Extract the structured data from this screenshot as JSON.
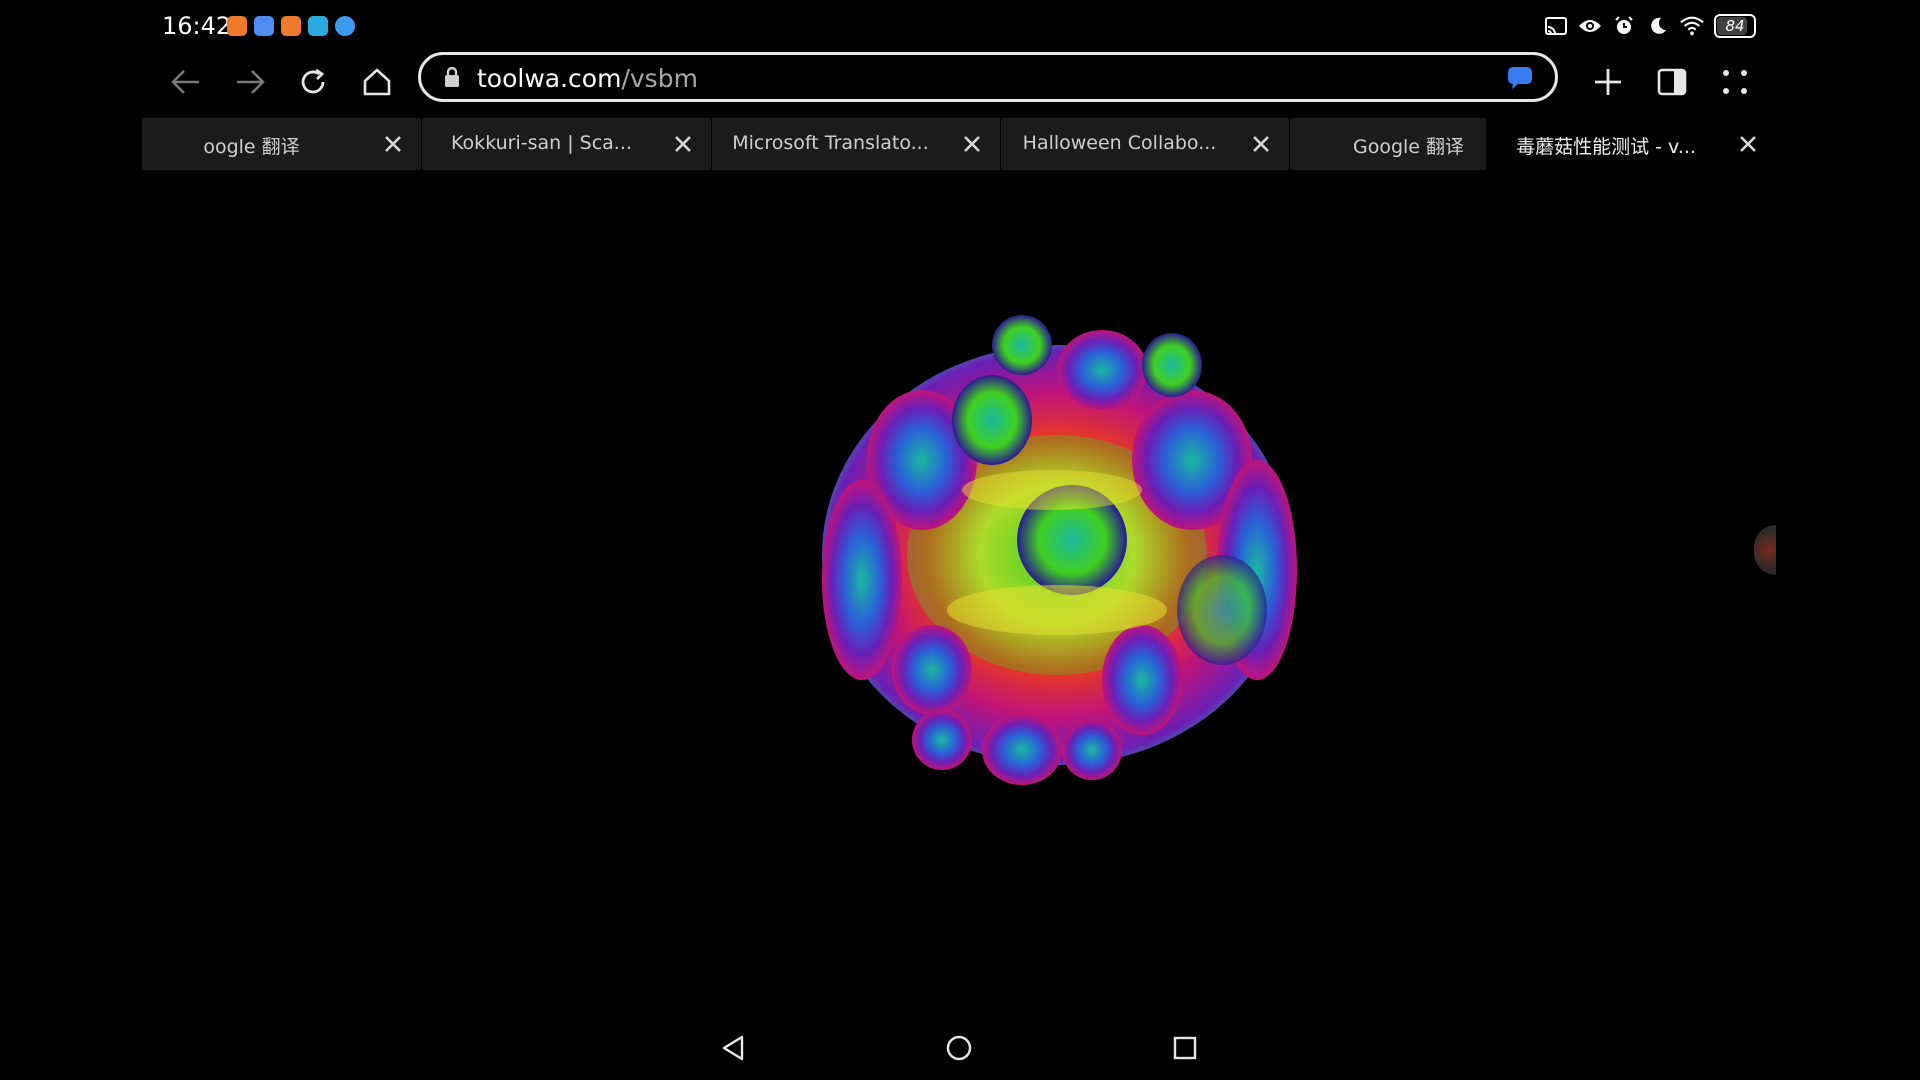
{
  "status_bar": {
    "time": "16:42",
    "notification_apps": [
      {
        "icon": "orange-app-icon",
        "color": "#ef7a2a"
      },
      {
        "icon": "blue-bird-app-icon",
        "color": "#4e8cf0"
      },
      {
        "icon": "orange-app-icon",
        "color": "#ef7a2a"
      },
      {
        "icon": "play-app-icon",
        "color": "#2aa8e0"
      },
      {
        "icon": "blue-circle-app-icon",
        "color": "#3a9cf0"
      }
    ],
    "icons": [
      "cast-icon",
      "eye-icon",
      "alarm-icon",
      "moon-icon",
      "wifi-icon"
    ],
    "battery_level": "84",
    "battery_fraction": 0.84
  },
  "toolbar": {
    "back": "back-arrow-icon",
    "forward": "forward-arrow-icon",
    "reload": "reload-icon",
    "home": "home-icon",
    "url_host": "toolwa.com",
    "url_path": "/vsbm",
    "new_tab": "plus-icon",
    "split_view": "split-view-icon",
    "menu": "dots-menu-icon"
  },
  "tabs": [
    {
      "label": "oogle 翻译",
      "active": false
    },
    {
      "label": "Kokkuri-san | Sca...",
      "active": false
    },
    {
      "label": "Microsoft Translato...",
      "active": false
    },
    {
      "label": "Halloween Collabo...",
      "active": false
    },
    {
      "label": "Google 翻译",
      "active": false
    },
    {
      "label": "毒蘑菇性能测试 - v...",
      "active": true
    }
  ],
  "content": {
    "fractal_colors": [
      "#2b1b8f",
      "#6a1fb5",
      "#c0147a",
      "#e83a1e",
      "#f0a020",
      "#e8e030",
      "#40d020",
      "#1ab8a0",
      "#2a60d8"
    ]
  },
  "nav_bar": {
    "back": "triangle-back-icon",
    "home": "circle-home-icon",
    "recents": "square-recents-icon"
  }
}
